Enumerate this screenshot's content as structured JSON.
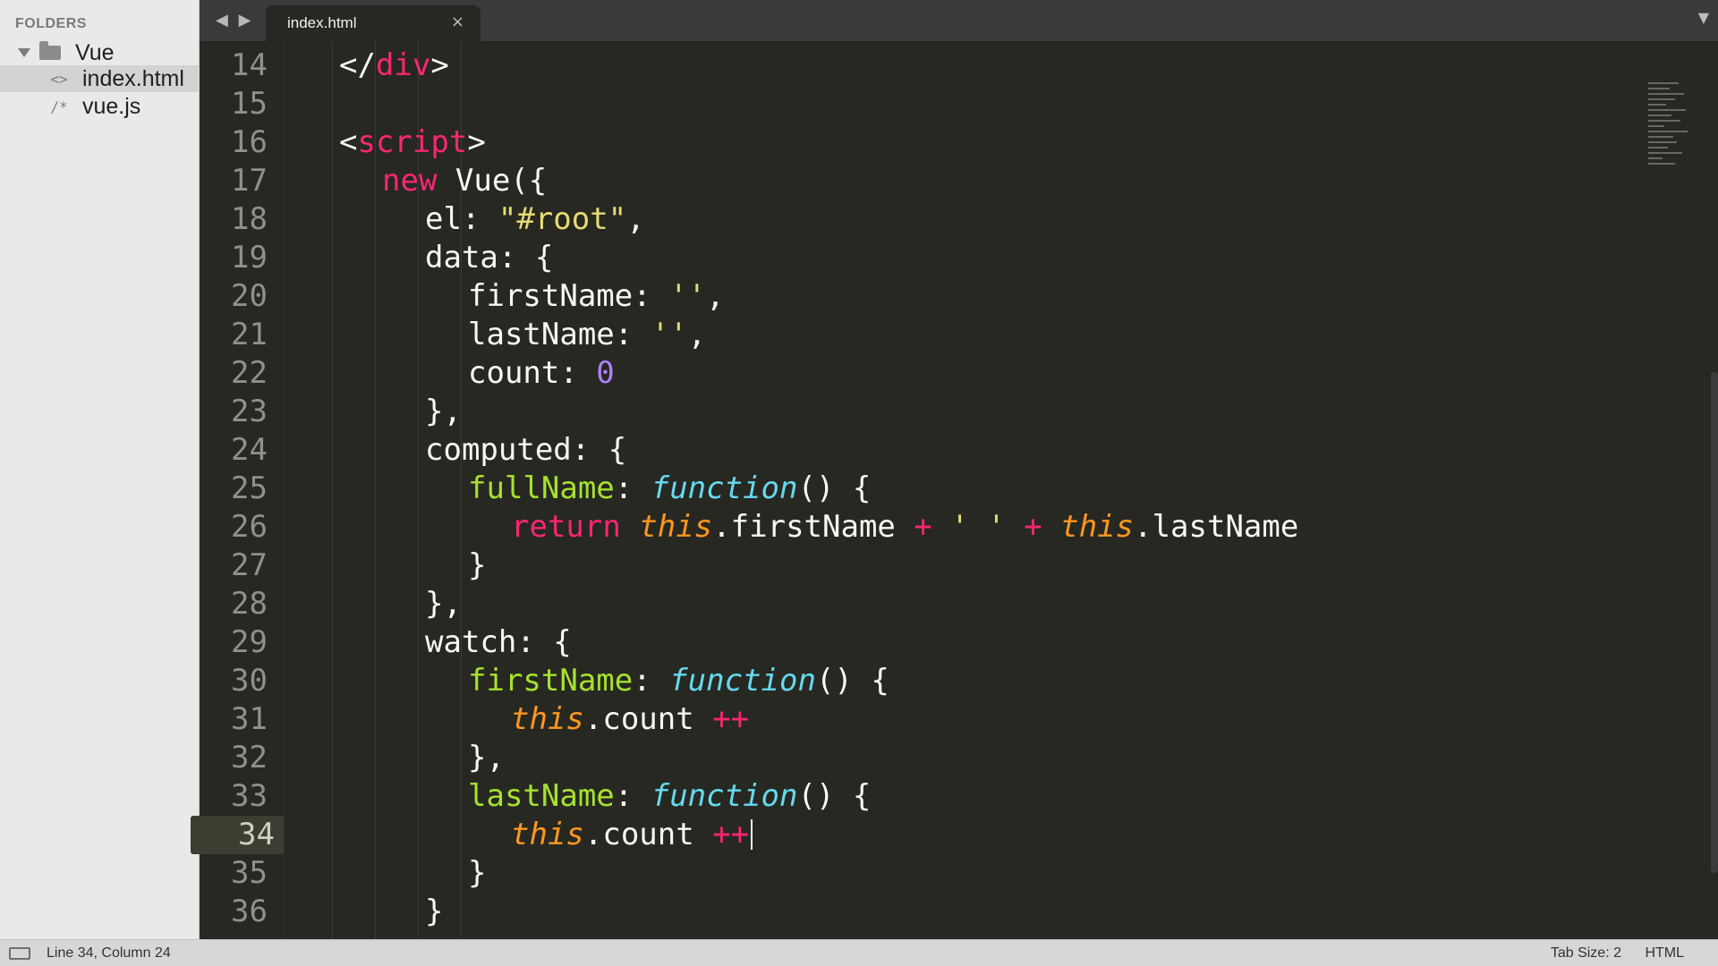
{
  "sidebar": {
    "title": "FOLDERS",
    "folder": "Vue",
    "files": [
      {
        "name": "index.html",
        "icon": "<>",
        "selected": true
      },
      {
        "name": "vue.js",
        "icon": "/*",
        "selected": false
      }
    ]
  },
  "tabbar": {
    "tab_title": "index.html",
    "close": "×",
    "nav_back": "◀",
    "nav_forward": "▶",
    "dropdown": "▼"
  },
  "editor": {
    "active_line": "34",
    "line_numbers": [
      "14",
      "15",
      "16",
      "17",
      "18",
      "19",
      "20",
      "21",
      "22",
      "23",
      "24",
      "25",
      "26",
      "27",
      "28",
      "29",
      "30",
      "31",
      "32",
      "33",
      "34",
      "35",
      "36"
    ],
    "lines": [
      {
        "n": "14",
        "segments": [
          {
            "t": "</",
            "c": ""
          },
          {
            "t": "div",
            "c": "tag"
          },
          {
            "t": ">",
            "c": ""
          }
        ],
        "indent": 1
      },
      {
        "n": "15",
        "segments": [],
        "indent": 0
      },
      {
        "n": "16",
        "segments": [
          {
            "t": "<",
            "c": ""
          },
          {
            "t": "script",
            "c": "tag"
          },
          {
            "t": ">",
            "c": ""
          }
        ],
        "indent": 1
      },
      {
        "n": "17",
        "segments": [
          {
            "t": "new",
            "c": "kw"
          },
          {
            "t": " Vue({",
            "c": ""
          }
        ],
        "indent": 2
      },
      {
        "n": "18",
        "segments": [
          {
            "t": "el: ",
            "c": ""
          },
          {
            "t": "\"#root\"",
            "c": "str"
          },
          {
            "t": ",",
            "c": ""
          }
        ],
        "indent": 3
      },
      {
        "n": "19",
        "segments": [
          {
            "t": "data: {",
            "c": ""
          }
        ],
        "indent": 3
      },
      {
        "n": "20",
        "segments": [
          {
            "t": "firstName: ",
            "c": ""
          },
          {
            "t": "''",
            "c": "str"
          },
          {
            "t": ",",
            "c": ""
          }
        ],
        "indent": 4
      },
      {
        "n": "21",
        "segments": [
          {
            "t": "lastName: ",
            "c": ""
          },
          {
            "t": "''",
            "c": "str"
          },
          {
            "t": ",",
            "c": ""
          }
        ],
        "indent": 4
      },
      {
        "n": "22",
        "segments": [
          {
            "t": "count: ",
            "c": ""
          },
          {
            "t": "0",
            "c": "num"
          }
        ],
        "indent": 4
      },
      {
        "n": "23",
        "segments": [
          {
            "t": "},",
            "c": ""
          }
        ],
        "indent": 3
      },
      {
        "n": "24",
        "segments": [
          {
            "t": "computed: {",
            "c": ""
          }
        ],
        "indent": 3
      },
      {
        "n": "25",
        "segments": [
          {
            "t": "fullName",
            "c": "fnname"
          },
          {
            "t": ": ",
            "c": ""
          },
          {
            "t": "function",
            "c": "fn"
          },
          {
            "t": "() {",
            "c": ""
          }
        ],
        "indent": 4
      },
      {
        "n": "26",
        "segments": [
          {
            "t": "return",
            "c": "kw"
          },
          {
            "t": " ",
            "c": ""
          },
          {
            "t": "this",
            "c": "this"
          },
          {
            "t": ".firstName ",
            "c": ""
          },
          {
            "t": "+",
            "c": "op"
          },
          {
            "t": " ",
            "c": ""
          },
          {
            "t": "' '",
            "c": "str"
          },
          {
            "t": " ",
            "c": ""
          },
          {
            "t": "+",
            "c": "op"
          },
          {
            "t": " ",
            "c": ""
          },
          {
            "t": "this",
            "c": "this"
          },
          {
            "t": ".lastName",
            "c": ""
          }
        ],
        "indent": 5
      },
      {
        "n": "27",
        "segments": [
          {
            "t": "}",
            "c": ""
          }
        ],
        "indent": 4
      },
      {
        "n": "28",
        "segments": [
          {
            "t": "},",
            "c": ""
          }
        ],
        "indent": 3
      },
      {
        "n": "29",
        "segments": [
          {
            "t": "watch: {",
            "c": ""
          }
        ],
        "indent": 3
      },
      {
        "n": "30",
        "segments": [
          {
            "t": "firstName",
            "c": "fnname"
          },
          {
            "t": ": ",
            "c": ""
          },
          {
            "t": "function",
            "c": "fn"
          },
          {
            "t": "() {",
            "c": ""
          }
        ],
        "indent": 4
      },
      {
        "n": "31",
        "segments": [
          {
            "t": "this",
            "c": "this"
          },
          {
            "t": ".count ",
            "c": ""
          },
          {
            "t": "++",
            "c": "op"
          }
        ],
        "indent": 5
      },
      {
        "n": "32",
        "segments": [
          {
            "t": "},",
            "c": ""
          }
        ],
        "indent": 4
      },
      {
        "n": "33",
        "segments": [
          {
            "t": "lastName",
            "c": "fnname"
          },
          {
            "t": ": ",
            "c": ""
          },
          {
            "t": "function",
            "c": "fn"
          },
          {
            "t": "() {",
            "c": ""
          }
        ],
        "indent": 4
      },
      {
        "n": "34",
        "segments": [
          {
            "t": "this",
            "c": "this"
          },
          {
            "t": ".count ",
            "c": ""
          },
          {
            "t": "++",
            "c": "op"
          }
        ],
        "indent": 5,
        "cursor": true
      },
      {
        "n": "35",
        "segments": [
          {
            "t": "}",
            "c": ""
          }
        ],
        "indent": 4
      },
      {
        "n": "36",
        "segments": [
          {
            "t": "}",
            "c": ""
          }
        ],
        "indent": 3
      }
    ]
  },
  "statusbar": {
    "position": "Line 34, Column 24",
    "tab_size": "Tab Size: 2",
    "syntax": "HTML"
  },
  "colors": {
    "background": "#272822",
    "tag": "#f92672",
    "function_name": "#a6e22e",
    "function_keyword": "#66d9ef",
    "this": "#fd971f",
    "string": "#e6db74",
    "number": "#ae81ff"
  },
  "icons": {
    "folder": "folder-icon",
    "collapse": "triangle-down-icon",
    "html_file": "html-file-icon",
    "js_file": "js-file-icon",
    "close": "close-icon",
    "status_panel": "panel-icon"
  }
}
